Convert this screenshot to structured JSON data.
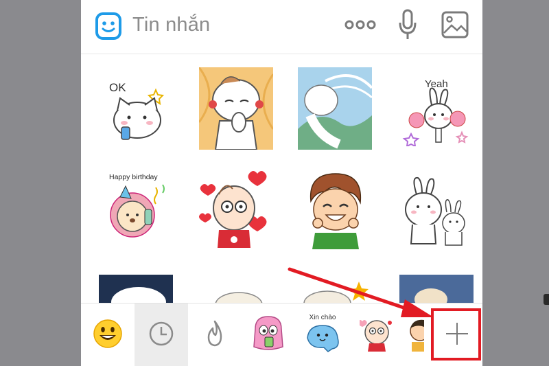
{
  "header": {
    "title": "Tin nhắn",
    "more_icon": "more-dots-icon",
    "mic_icon": "microphone-icon",
    "image_icon": "image-icon"
  },
  "stickers": {
    "row1": [
      {
        "name": "sticker-cat-ok",
        "caption": "OK"
      },
      {
        "name": "sticker-boy-shy",
        "caption": ""
      },
      {
        "name": "sticker-boy-wind",
        "caption": ""
      },
      {
        "name": "sticker-rabbit-yeah",
        "caption": "Yeah"
      }
    ],
    "row2": [
      {
        "name": "sticker-lion-birthday",
        "caption": "Happy birthday"
      },
      {
        "name": "sticker-baby-hearts",
        "caption": ""
      },
      {
        "name": "sticker-boy-smile",
        "caption": ""
      },
      {
        "name": "sticker-rabbits-pair",
        "caption": ""
      }
    ]
  },
  "tray": {
    "items": [
      {
        "name": "tray-emoji",
        "icon": "smiley-emoji-icon"
      },
      {
        "name": "tray-recent",
        "icon": "clock-icon"
      },
      {
        "name": "tray-trending",
        "icon": "flame-icon"
      },
      {
        "name": "tray-pack-pink",
        "icon": "pink-monster-sticker-icon"
      },
      {
        "name": "tray-pack-xinchao",
        "icon": "blue-bird-sticker-icon",
        "caption": "Xin chào"
      },
      {
        "name": "tray-pack-baby",
        "icon": "baby-sticker-icon"
      },
      {
        "name": "tray-pack-boy",
        "icon": "boy-sticker-icon"
      }
    ],
    "add_icon": "plus-icon"
  },
  "colors": {
    "accent_blue": "#1e9be8",
    "highlight_red": "#e21b23",
    "icon_gray": "#7a7a7a",
    "frame_gray": "#8a8a8e"
  }
}
